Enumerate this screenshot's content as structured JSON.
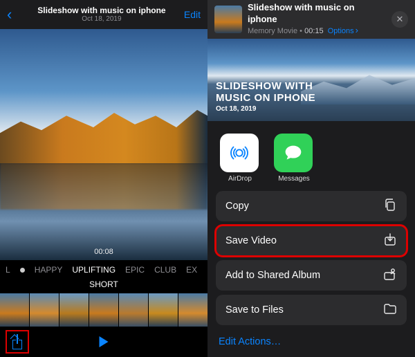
{
  "left": {
    "header": {
      "title": "Slideshow with music on iphone",
      "subtitle": "Oct 18, 2019",
      "edit": "Edit"
    },
    "current_time": "00:08",
    "moods": {
      "items": [
        "L",
        "HAPPY",
        "UPLIFTING",
        "EPIC",
        "CLUB",
        "EX"
      ],
      "selected": "UPLIFTING",
      "duration_label": "SHORT"
    }
  },
  "right": {
    "header": {
      "title": "Slideshow with music on iphone",
      "kind": "Memory Movie",
      "duration": "00:15",
      "options": "Options"
    },
    "preview": {
      "line1": "SLIDESHOW WITH",
      "line2": "MUSIC ON IPHONE",
      "date": "Oct 18, 2019"
    },
    "share_targets": {
      "airdrop": "AirDrop",
      "messages": "Messages"
    },
    "actions": {
      "copy": "Copy",
      "save_video": "Save Video",
      "add_shared": "Add to Shared Album",
      "save_files": "Save to Files",
      "edit_actions": "Edit Actions…"
    }
  }
}
